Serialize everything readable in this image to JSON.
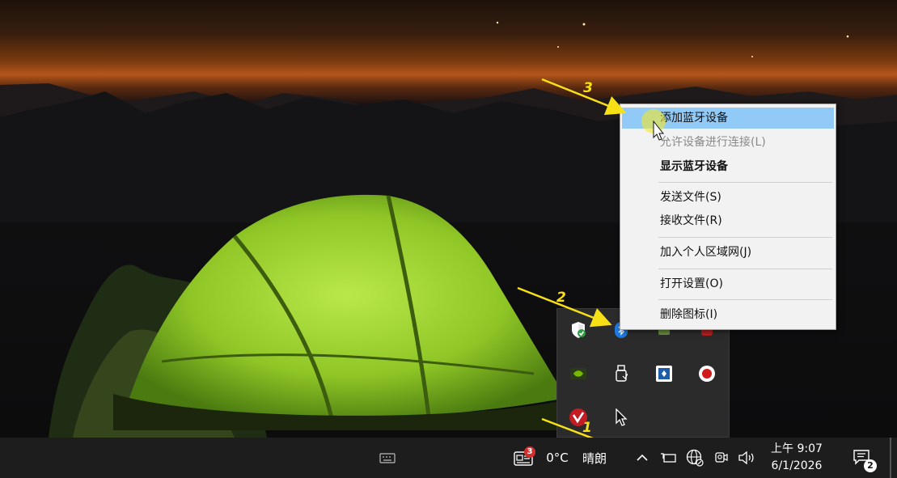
{
  "context_menu": {
    "items": [
      {
        "label": "添加蓝牙设备",
        "state": "hover"
      },
      {
        "label": "允许设备进行连接(L)",
        "state": "disabled"
      },
      {
        "label": "显示蓝牙设备",
        "state": "bold"
      },
      {
        "label": "发送文件(S)",
        "state": "normal"
      },
      {
        "label": "接收文件(R)",
        "state": "normal"
      },
      {
        "label": "加入个人区域网(J)",
        "state": "normal"
      },
      {
        "label": "打开设置(O)",
        "state": "normal"
      },
      {
        "label": "删除图标(I)",
        "state": "normal"
      }
    ]
  },
  "tray_overflow": {
    "icons": [
      "windows-security-icon",
      "bluetooth-icon",
      "gpu-icon",
      "red-app-icon",
      "nvidia-icon",
      "usb-drive-icon",
      "blue-app-icon",
      "record-icon",
      "antivirus-icon",
      "cursor-icon"
    ]
  },
  "annotations": {
    "step1": "1",
    "step2": "2",
    "step3": "3",
    "color": "#f7e016"
  },
  "taskbar": {
    "keyboard_icon": "keyboard-icon",
    "news_badge": "3",
    "temperature": "0°C",
    "weather": "晴朗",
    "show_hidden_icon": "chevron-up-icon",
    "clock_time": "上午 9:07",
    "clock_date": "6/1/2026",
    "notification_count": "2"
  },
  "colors": {
    "taskbar_bg": "#1d1d1d",
    "menu_bg": "#f2f2f2",
    "menu_hover": "#91c9f7",
    "tray_bg": "#2b2b2b"
  }
}
